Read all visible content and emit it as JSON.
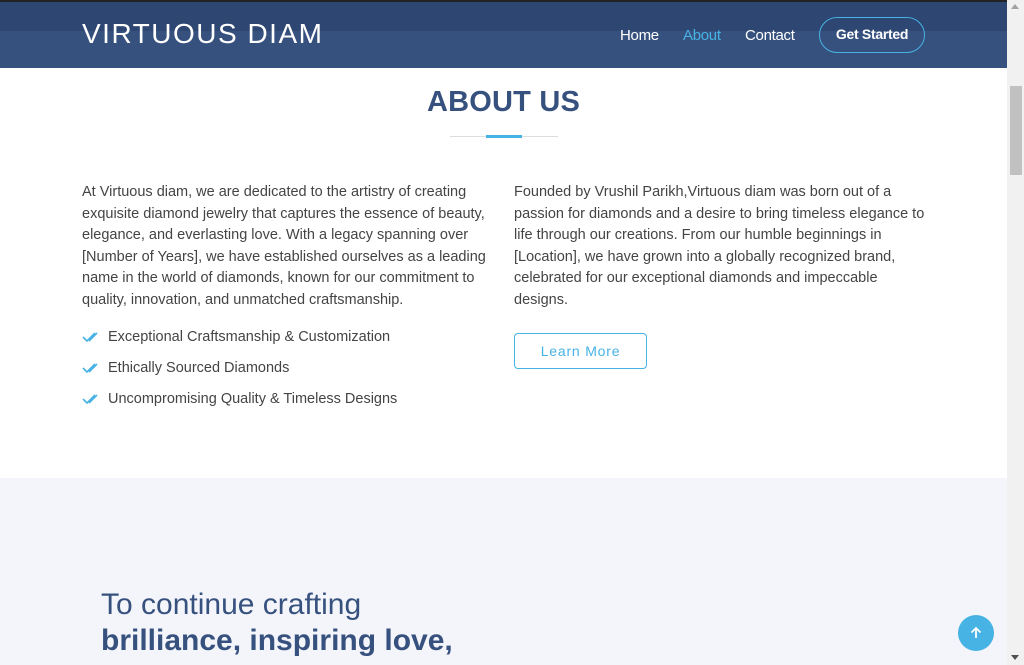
{
  "header": {
    "logo": "VIRTUOUS DIAM",
    "nav": {
      "home": "Home",
      "about": "About",
      "contact": "Contact"
    },
    "cta": "Get Started",
    "active_nav": "About"
  },
  "about": {
    "title": "ABOUT US",
    "left_paragraph": "At Virtuous diam, we are dedicated to the artistry of creating exquisite diamond jewelry that captures the essence of beauty, elegance, and everlasting love. With a legacy spanning over [Number of Years], we have established ourselves as a leading name in the world of diamonds, known for our commitment to quality, innovation, and unmatched craftsmanship.",
    "right_paragraph": "Founded by Vrushil Parikh,Virtuous diam was born out of a passion for diamonds and a desire to bring timeless elegance to life through our creations. From our humble beginnings in [Location], we have grown into a globally recognized brand, celebrated for our exceptional diamonds and impeccable designs.",
    "features": [
      "Exceptional Craftsmanship & Customization",
      "Ethically Sourced Diamonds",
      "Uncompromising Quality & Timeless Designs"
    ],
    "learn_more": "Learn More"
  },
  "lower": {
    "line1": "To continue crafting",
    "line2": "brilliance, inspiring love,"
  },
  "colors": {
    "brand": "#37517e",
    "accent": "#47b2e4",
    "light_bg": "#f3f5fa"
  },
  "icons": {
    "feature": "double-check-icon",
    "back_to_top": "arrow-up-icon"
  }
}
